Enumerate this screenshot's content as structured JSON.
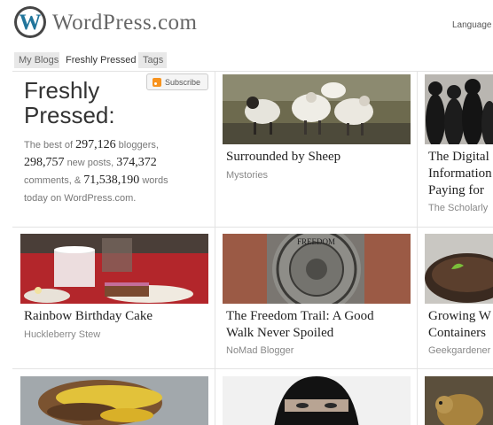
{
  "header": {
    "logo_icon": "wordpress-logo-icon",
    "wordmark": "WordPress.com",
    "language_label": "Language"
  },
  "tabs": [
    {
      "label": "My Blogs",
      "active": false
    },
    {
      "label": "Freshly Pressed",
      "active": true
    },
    {
      "label": "Tags",
      "active": false
    }
  ],
  "intro": {
    "title": "Freshly Pressed:",
    "subscribe_label": "Subscribe",
    "subscribe_icon": "rss-icon",
    "stats": {
      "prefix": "The best of",
      "bloggers_count": "297,126",
      "bloggers_label": "bloggers,",
      "posts_count": "298,757",
      "posts_label": "new posts,",
      "comments_count": "374,372",
      "comments_label": "comments, &",
      "words_count": "71,538,190",
      "words_label": "words",
      "suffix": "today on WordPress.com."
    }
  },
  "posts": [
    {
      "title_lines": [
        "Surrounded by Sheep"
      ],
      "blog": "Mystories",
      "thumb": "sheep"
    },
    {
      "title_lines": [
        "The Digital",
        "Information",
        "Paying for"
      ],
      "blog": "The Scholarly",
      "thumb": "silhouettes"
    },
    {
      "title_lines": [
        "Rainbow Birthday Cake"
      ],
      "blog": "Huckleberry Stew",
      "thumb": "cake"
    },
    {
      "title_lines": [
        "The Freedom Trail: A Good",
        "Walk Never Spoiled"
      ],
      "blog": "NoMad Blogger",
      "thumb": "freedom-trail"
    },
    {
      "title_lines": [
        "Growing W",
        "Containers"
      ],
      "blog": "Geekgardener",
      "thumb": "seedling"
    },
    {
      "thumb": "burger"
    },
    {
      "thumb": "niqab"
    },
    {
      "thumb": "squirrel"
    }
  ],
  "colors": {
    "brand_blue": "#21759b",
    "rss_orange": "#f7931e"
  }
}
